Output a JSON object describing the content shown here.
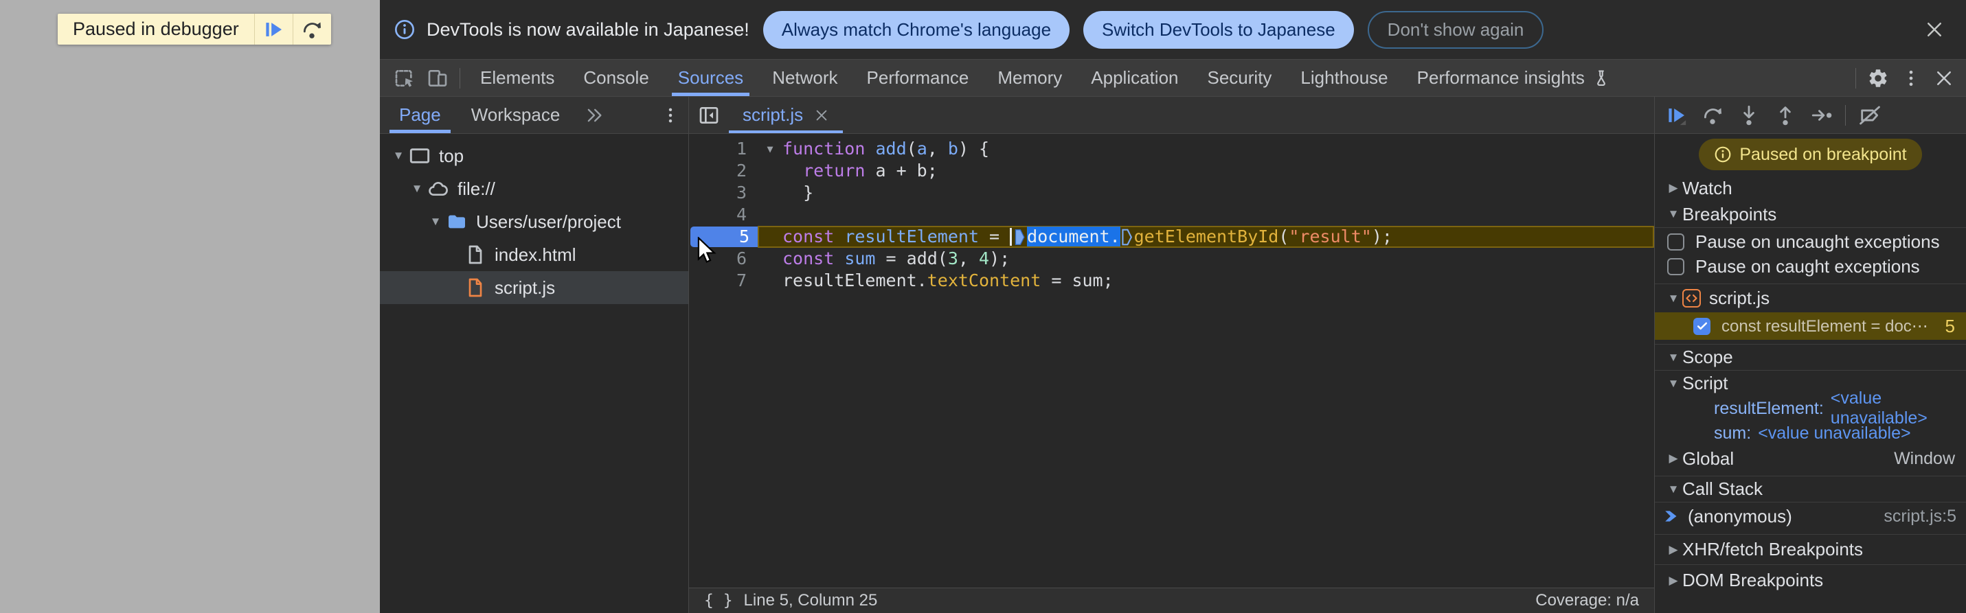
{
  "colors": {
    "accent_blue": "#82abf8",
    "selection_blue": "#1a73e8",
    "breakpoint_blue": "#4f83e8",
    "exec_line_bg": "#473a02",
    "paused_badge_bg": "#564a12",
    "paused_badge_text": "#f2e48c",
    "file_orange": "#ee8445",
    "folder_blue": "#73a7f0",
    "overlay_yellow": "#fcf4cd"
  },
  "page_overlay": {
    "message": "Paused in debugger",
    "buttons": [
      {
        "icon": "resume-icon"
      },
      {
        "icon": "step-over-icon"
      }
    ]
  },
  "notification": {
    "icon": "info-icon",
    "message": "DevTools is now available in Japanese!",
    "buttons": [
      {
        "label": "Always match Chrome's language",
        "style": "blue"
      },
      {
        "label": "Switch DevTools to Japanese",
        "style": "blue"
      },
      {
        "label": "Don't show again",
        "style": "ghost"
      }
    ],
    "close_icon": "close-icon"
  },
  "tabbar": {
    "left_icons": [
      "inspect-icon",
      "device-toolbar-icon"
    ],
    "tabs": [
      "Elements",
      "Console",
      "Sources",
      "Network",
      "Performance",
      "Memory",
      "Application",
      "Security",
      "Lighthouse",
      "Performance insights"
    ],
    "active": "Sources",
    "flask_on": "Performance insights",
    "right_icons": [
      "gear-icon",
      "kebab-icon",
      "close-icon"
    ]
  },
  "navigator": {
    "tabs": [
      "Page",
      "Workspace"
    ],
    "active_tab": "Page",
    "more_icon": "chevrons-icon",
    "menu_icon": "kebab-icon",
    "tree": [
      {
        "label": "top",
        "icon": "frame-icon",
        "depth": 0,
        "arrow": "down"
      },
      {
        "label": "file://",
        "icon": "cloud-icon",
        "depth": 1,
        "arrow": "down"
      },
      {
        "label": "Users/user/project",
        "icon": "folder-icon",
        "depth": 2,
        "arrow": "down"
      },
      {
        "label": "index.html",
        "icon": "file-icon",
        "depth": 3,
        "arrow": "none"
      },
      {
        "label": "script.js",
        "icon": "file-orange-icon",
        "depth": 3,
        "arrow": "none",
        "selected": true
      }
    ]
  },
  "editor": {
    "toggle_icon": "panel-left-icon",
    "tab": {
      "label": "script.js",
      "close_icon": "close-icon"
    },
    "paused_line": 5,
    "lines": [
      {
        "num": 1,
        "fold": "down",
        "tokens": [
          {
            "c": "kw",
            "t": "function"
          },
          {
            "c": "pl",
            "t": " "
          },
          {
            "c": "def",
            "t": "add"
          },
          {
            "c": "pl",
            "t": "("
          },
          {
            "c": "def",
            "t": "a"
          },
          {
            "c": "pl",
            "t": ", "
          },
          {
            "c": "def",
            "t": "b"
          },
          {
            "c": "pl",
            "t": ") {"
          }
        ]
      },
      {
        "num": 2,
        "guide": true,
        "tokens": [
          {
            "c": "pl",
            "t": "  "
          },
          {
            "c": "kw",
            "t": "return"
          },
          {
            "c": "pl",
            "t": " a + b;"
          }
        ]
      },
      {
        "num": 3,
        "guide": true,
        "tokens": [
          {
            "c": "pl",
            "t": "  }"
          }
        ]
      },
      {
        "num": 4,
        "tokens": []
      },
      {
        "num": 5,
        "exec": true,
        "tokens": [
          {
            "c": "kw",
            "t": "const"
          },
          {
            "c": "pl",
            "t": " "
          },
          {
            "c": "def",
            "t": "resultElement"
          },
          {
            "c": "pl",
            "t": " = "
          },
          {
            "c": "caret",
            "t": ""
          },
          {
            "c": "marker_filled",
            "t": ""
          },
          {
            "c": "sel",
            "t": "document."
          },
          {
            "c": "marker_outline",
            "t": ""
          },
          {
            "c": "prop",
            "t": "getElementById"
          },
          {
            "c": "pl",
            "t": "("
          },
          {
            "c": "str",
            "t": "\"result\""
          },
          {
            "c": "pl",
            "t": ");"
          }
        ]
      },
      {
        "num": 6,
        "tokens": [
          {
            "c": "kw",
            "t": "const"
          },
          {
            "c": "pl",
            "t": " "
          },
          {
            "c": "def",
            "t": "sum"
          },
          {
            "c": "pl",
            "t": " = add("
          },
          {
            "c": "num",
            "t": "3"
          },
          {
            "c": "pl",
            "t": ", "
          },
          {
            "c": "num",
            "t": "4"
          },
          {
            "c": "pl",
            "t": ");"
          }
        ]
      },
      {
        "num": 7,
        "tokens": [
          {
            "c": "pl",
            "t": "resultElement."
          },
          {
            "c": "prop",
            "t": "textContent"
          },
          {
            "c": "pl",
            "t": " = sum;"
          }
        ]
      }
    ],
    "status": {
      "braces": "{ }",
      "position": "Line 5, Column 25",
      "coverage": "Coverage: n/a"
    }
  },
  "debugger": {
    "toolbar_icons": [
      "resume-icon",
      "step-over-icon",
      "step-into-icon",
      "step-out-icon",
      "step-icon",
      "deactivate-breakpoints-icon"
    ],
    "paused_badge": "Paused on breakpoint",
    "watch_label": "Watch",
    "breakpoints_label": "Breakpoints",
    "pause_uncaught_label": "Pause on uncaught exceptions",
    "pause_caught_label": "Pause on caught exceptions",
    "breakpoint_group": {
      "file": "script.js",
      "items": [
        {
          "code": "const resultElement = doc⋯",
          "line": "5",
          "checked": true
        }
      ]
    },
    "scope_label": "Scope",
    "scope_script_label": "Script",
    "scope_vars": [
      {
        "name": "resultElement",
        "value": "<value unavailable>"
      },
      {
        "name": "sum",
        "value": "<value unavailable>"
      }
    ],
    "global_label": "Global",
    "global_value": "Window",
    "callstack_label": "Call Stack",
    "frames": [
      {
        "name": "(anonymous)",
        "location": "script.js:5"
      }
    ],
    "xhr_label": "XHR/fetch Breakpoints",
    "dom_label": "DOM Breakpoints"
  }
}
